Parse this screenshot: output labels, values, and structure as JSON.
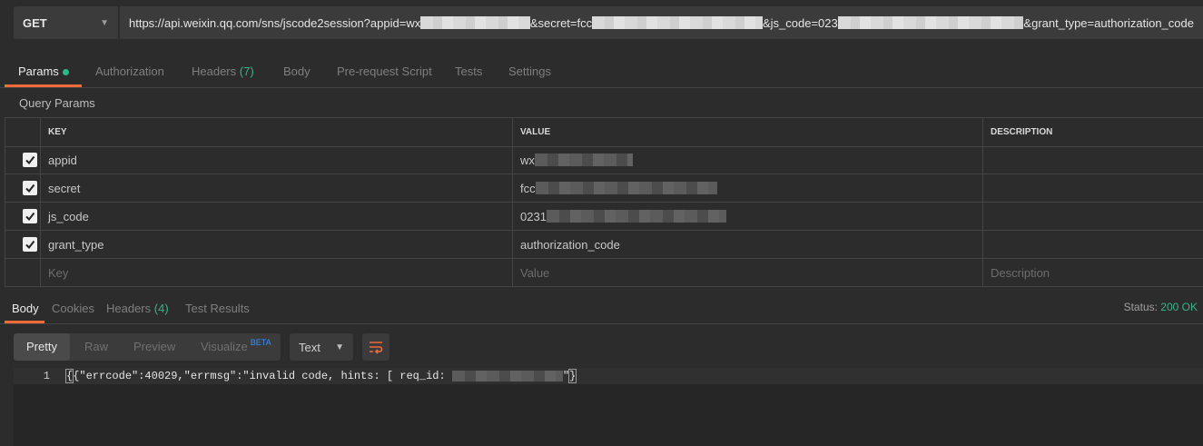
{
  "request": {
    "method": "GET",
    "url_parts": [
      "https://api.weixin.qq.com/sns/jscode2session?appid=wx",
      "&secret=fcc",
      "&js_code=023",
      "&grant_type=authorization_code"
    ]
  },
  "request_tabs": [
    {
      "label": "Params",
      "active": true,
      "dot": true
    },
    {
      "label": "Authorization"
    },
    {
      "label": "Headers",
      "count": "(7)"
    },
    {
      "label": "Body"
    },
    {
      "label": "Pre-request Script"
    },
    {
      "label": "Tests"
    },
    {
      "label": "Settings"
    }
  ],
  "query_params": {
    "title": "Query Params",
    "columns": [
      "KEY",
      "VALUE",
      "DESCRIPTION"
    ],
    "rows": [
      {
        "checked": true,
        "key": "appid",
        "value": "wx"
      },
      {
        "checked": true,
        "key": "secret",
        "value": "fcc"
      },
      {
        "checked": true,
        "key": "js_code",
        "value": "0231"
      },
      {
        "checked": true,
        "key": "grant_type",
        "value": "authorization_code"
      }
    ],
    "placeholders": {
      "key": "Key",
      "value": "Value",
      "description": "Description"
    }
  },
  "response_tabs": [
    {
      "label": "Body",
      "active": true
    },
    {
      "label": "Cookies"
    },
    {
      "label": "Headers",
      "count": "(4)"
    },
    {
      "label": "Test Results"
    }
  ],
  "status": {
    "label": "Status:",
    "value": "200 OK"
  },
  "view_modes": [
    {
      "label": "Pretty",
      "active": true
    },
    {
      "label": "Raw"
    },
    {
      "label": "Preview"
    },
    {
      "label": "Visualize",
      "badge": "BETA"
    }
  ],
  "format_select": "Text",
  "body": {
    "line_number": "1",
    "text_before": "{\"errcode\":40029,\"errmsg\":\"invalid code, hints: [ req_id: ",
    "text_after": "\"}"
  },
  "colors": {
    "accent": "#f26b3a",
    "ok_green": "#3ab38b",
    "beta_blue": "#3f8ef0"
  }
}
